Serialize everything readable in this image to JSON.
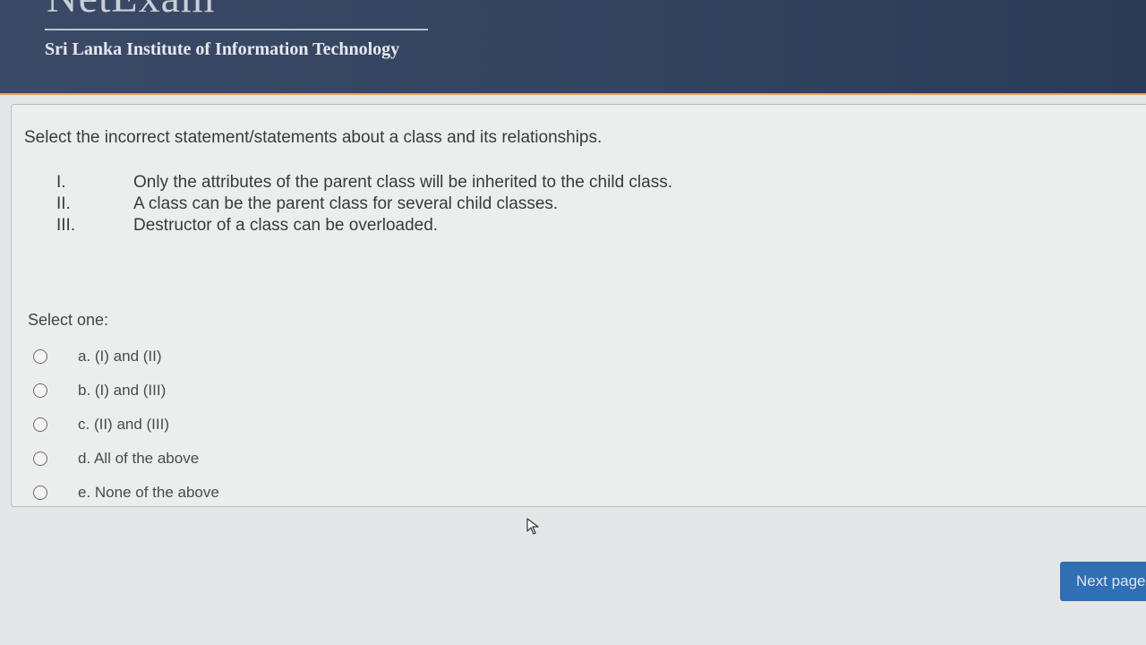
{
  "header": {
    "brand_title": "NetExam",
    "institute": "Sri Lanka Institute of Information Technology"
  },
  "question": {
    "prompt": "Select the incorrect statement/statements about a class and its relationships.",
    "statements": [
      {
        "num": "I.",
        "text": "Only the attributes of the parent class will be inherited to the child class."
      },
      {
        "num": "II.",
        "text": "A class can be the parent class for several child classes."
      },
      {
        "num": "III.",
        "text": "Destructor of a class can be overloaded."
      }
    ],
    "select_one_label": "Select one:",
    "options": [
      {
        "label": "a. (I) and (II)",
        "selected": false
      },
      {
        "label": "b. (I) and (III)",
        "selected": false
      },
      {
        "label": "c. (II) and (III)",
        "selected": false
      },
      {
        "label": "d. All of the above",
        "selected": false
      },
      {
        "label": "e. None of the above",
        "selected": false
      }
    ]
  },
  "footer": {
    "next_label": "Next page"
  },
  "colors": {
    "header_bg": "#34445f",
    "header_accent": "#e8a64a",
    "button_bg": "#2f6fb3"
  }
}
